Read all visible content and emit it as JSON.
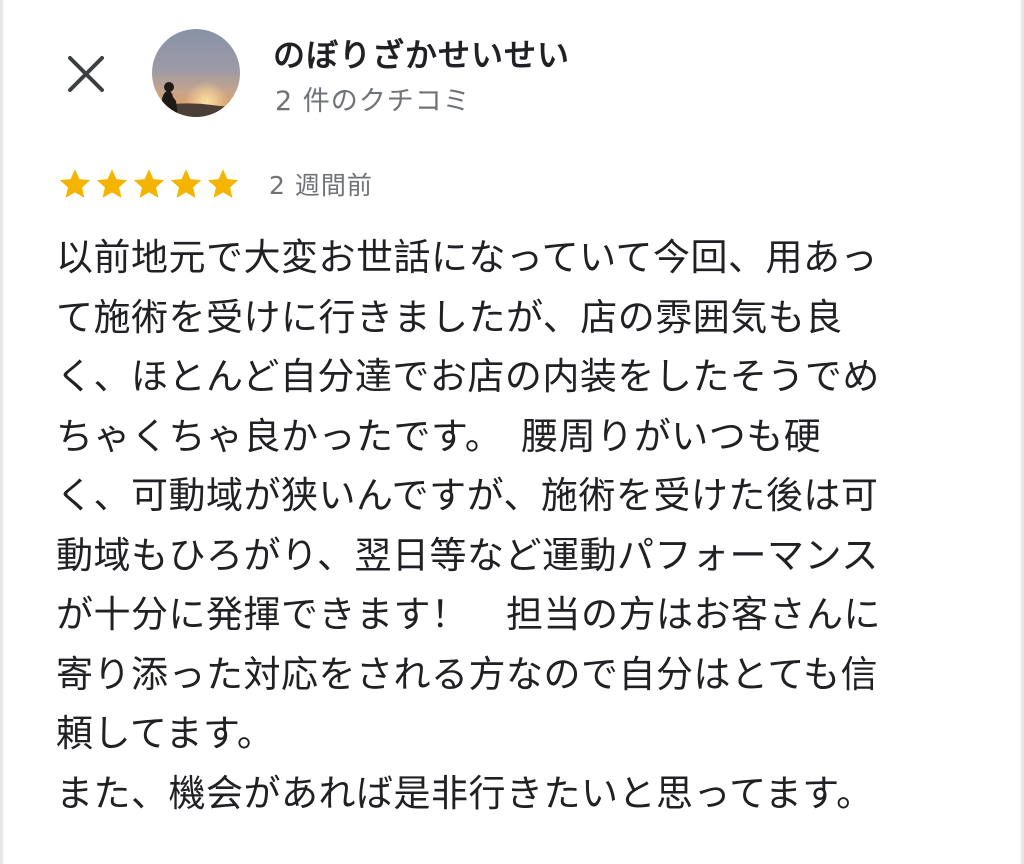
{
  "header": {
    "reviewer_name": "のぼりざかせいせい",
    "review_count": "2 件のクチコミ",
    "close_icon": "close-icon",
    "avatar": "avatar-sunset-silhouette"
  },
  "review": {
    "rating": 5,
    "rating_max": 5,
    "star_color": "#f4b400",
    "time": "2 週間前",
    "lines": [
      "以前地元で大変お世話になっていて今回、用あっ",
      "て施術を受けに行きましたが、店の雰囲気も良",
      "く、ほとんど自分達でお店の内装をしたそうでめ",
      "ちゃくちゃ良かったです。　腰周りがいつも硬",
      "く、可動域が狭いんですが、施術を受けた後は可",
      "動域もひろがり、翌日等など運動パフォーマンス",
      "が十分に発揮できます！　担当の方はお客さんに",
      "寄り添った対応をされる方なので自分はとても信",
      "頼してます。",
      "また、機会があれば是非行きたいと思ってます。"
    ]
  },
  "colors": {
    "text_primary": "#202124",
    "text_secondary": "#6f7378",
    "star": "#f4b400"
  }
}
